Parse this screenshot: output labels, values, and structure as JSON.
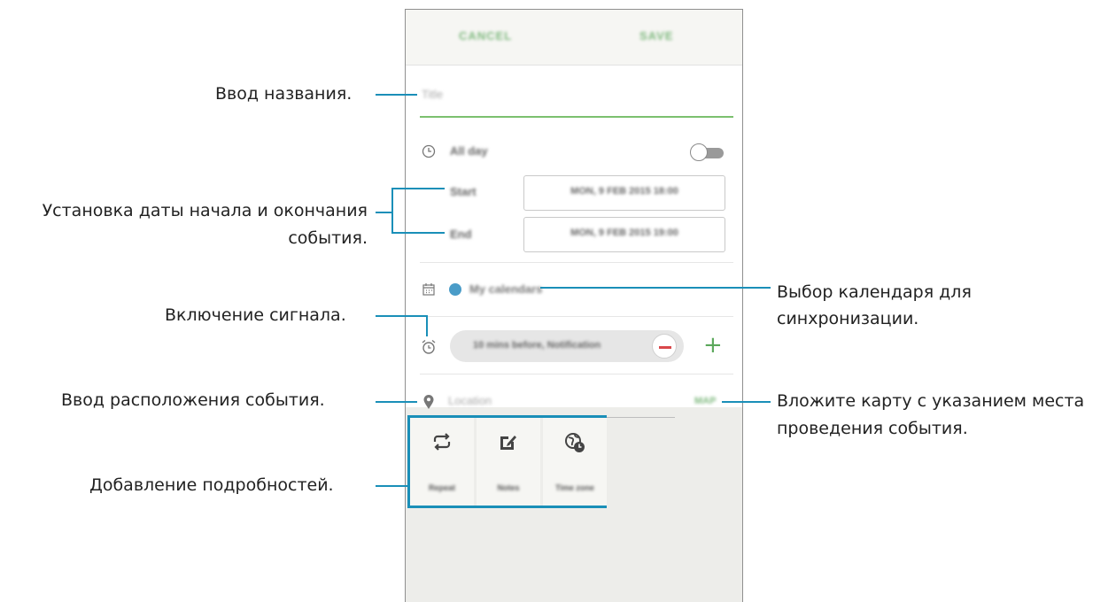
{
  "annotations": {
    "title_input": "Ввод названия.",
    "dates_line1": "Установка даты начала и окончания",
    "dates_line2": "события.",
    "alarm": "Включение сигнала.",
    "location": "Ввод расположения события.",
    "details": "Добавление подробностей.",
    "calendar_line1": "Выбор календаря для",
    "calendar_line2": "синхронизации.",
    "map_line1": "Вложите карту с указанием места",
    "map_line2": "проведения события."
  },
  "phone": {
    "cancel_label": "CANCEL",
    "save_label": "SAVE",
    "title_placeholder": "Title",
    "all_day_label": "All day",
    "start_label": "Start",
    "start_value": "MON, 9 FEB 2015   18:00",
    "end_label": "End",
    "end_value": "MON, 9 FEB 2015   19:00",
    "calendar_value": "My calendars",
    "reminder_value": "10 mins before, Notification",
    "location_placeholder": "Location",
    "map_label": "MAP",
    "details": [
      "Repeat",
      "Notes",
      "Time zone"
    ]
  },
  "colors": {
    "accent_line": "#1a8fb8",
    "calendar_dot": "#4a9cc8",
    "input_underline": "#7cc06e"
  }
}
